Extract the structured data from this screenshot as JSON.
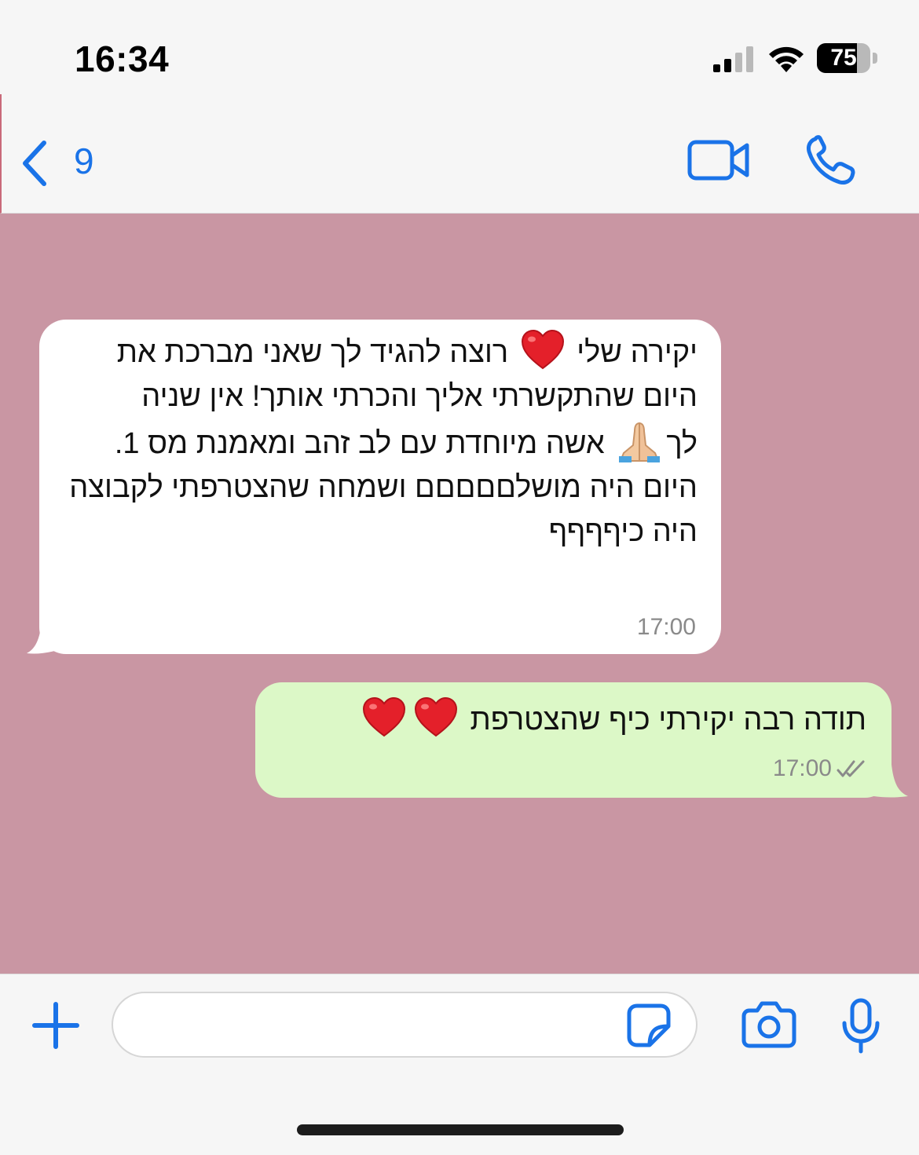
{
  "status_bar": {
    "time": "16:34",
    "battery_level": "75",
    "battery_fraction": 0.75
  },
  "header": {
    "back_count": "9",
    "icons": [
      "chevron-left-icon",
      "video-camera-icon",
      "phone-icon"
    ]
  },
  "colors": {
    "accent": "#1a73e8",
    "chat_background": "#c996a3",
    "incoming_bubble": "#ffffff",
    "outgoing_bubble": "#dcf8c7"
  },
  "messages": [
    {
      "direction": "incoming",
      "line1_before_heart": "יקירה שלי",
      "line1_after_heart": "רוצה להגיד לך שאני מברכת את",
      "line2": "היום שהתקשרתי אליך והכרתי אותך! אין שניה",
      "line3_before_emoji": "לך",
      "line3_after_emoji": "אשה מיוחדת עם לב זהב ומאמנת מס 1.",
      "line4": "היום היה מושלםםםםם ושמחה שהצטרפתי לקבוצה היה כיףףףף",
      "time": "17:00",
      "emojis": [
        "red-heart",
        "folded-hands"
      ]
    },
    {
      "direction": "outgoing",
      "text": "תודה רבה יקירתי כיף שהצטרפת",
      "time": "17:00",
      "emojis": [
        "red-heart",
        "red-heart"
      ],
      "status_icon": "double-check-icon"
    }
  ],
  "composer": {
    "placeholder": "",
    "icons": [
      "plus-icon",
      "sticker-icon",
      "camera-icon",
      "microphone-icon"
    ]
  }
}
